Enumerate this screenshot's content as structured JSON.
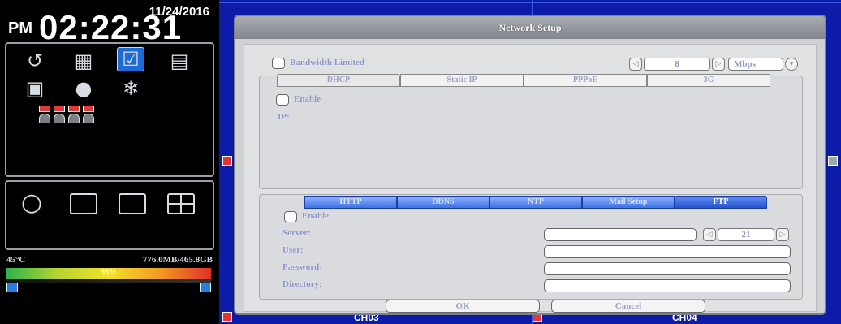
{
  "clock": {
    "date": "11/24/2016",
    "ampm": "PM",
    "time": "02:22:31"
  },
  "status": {
    "temperature": "45°C",
    "disk": "776.0MB/465.8GB",
    "disk_percent": "99%"
  },
  "channels": [
    "CH03",
    "CH04"
  ],
  "dialog": {
    "title": "Network Setup",
    "bandwidth": {
      "label": "Bandwidth Limited",
      "value": "8",
      "unit": "Mbps"
    },
    "conn_tabs": [
      "DHCP",
      "Static IP",
      "PPPoE",
      "3G"
    ],
    "conn_active": "DHCP",
    "conn_enable": "Enable",
    "ip_label": "IP:",
    "svc_tabs": [
      "HTTP",
      "DDNS",
      "NTP",
      "Mail Setup",
      "FTP"
    ],
    "svc_active": "FTP",
    "ftp_enable": "Enable",
    "server_label": "Server:",
    "port_value": "21",
    "user_label": "User:",
    "password_label": "Password:",
    "directory_label": "Directory:",
    "ok": "OK",
    "cancel": "Cancel"
  }
}
